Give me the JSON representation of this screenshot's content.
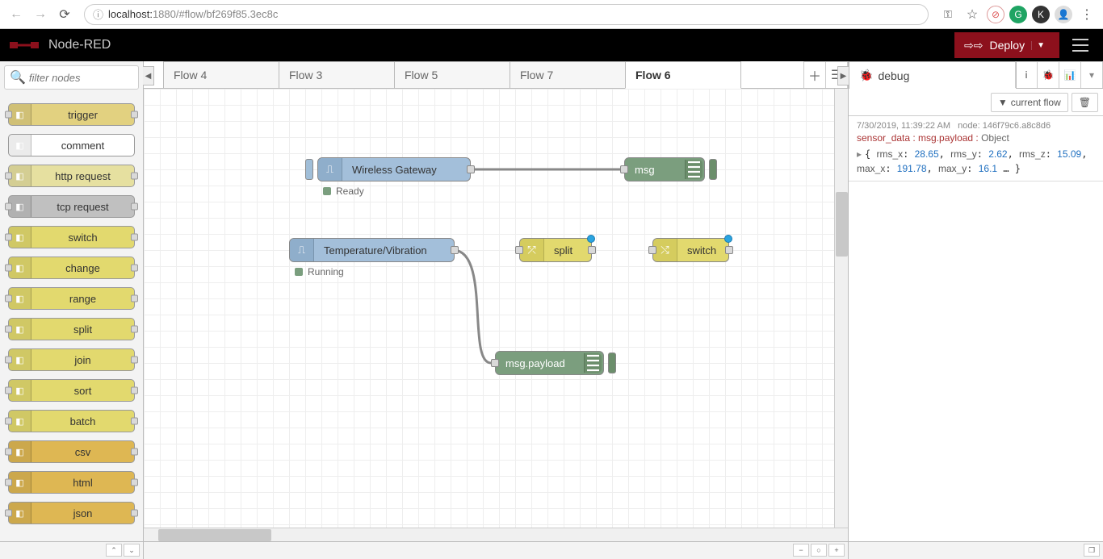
{
  "browser": {
    "url_host": "localhost:",
    "url_port_path": "1880/#flow/bf269f85.3ec8c"
  },
  "header": {
    "title": "Node-RED",
    "deploy_label": "Deploy"
  },
  "palette": {
    "filter_placeholder": "filter nodes",
    "nodes": [
      {
        "label": "trigger",
        "color": "#e2d180",
        "ports": "both"
      },
      {
        "label": "comment",
        "color": "#ffffff",
        "ports": "none"
      },
      {
        "label": "http request",
        "color": "#e6e0a0",
        "ports": "both"
      },
      {
        "label": "tcp request",
        "color": "#c0c0c0",
        "ports": "both"
      },
      {
        "label": "switch",
        "color": "#e2d96e",
        "ports": "both"
      },
      {
        "label": "change",
        "color": "#e2d96e",
        "ports": "both"
      },
      {
        "label": "range",
        "color": "#e2d96e",
        "ports": "both"
      },
      {
        "label": "split",
        "color": "#e2d96e",
        "ports": "both"
      },
      {
        "label": "join",
        "color": "#e2d96e",
        "ports": "both"
      },
      {
        "label": "sort",
        "color": "#e2d96e",
        "ports": "both"
      },
      {
        "label": "batch",
        "color": "#e2d96e",
        "ports": "both"
      },
      {
        "label": "csv",
        "color": "#deb753",
        "ports": "both"
      },
      {
        "label": "html",
        "color": "#deb753",
        "ports": "both"
      },
      {
        "label": "json",
        "color": "#deb753",
        "ports": "both"
      }
    ]
  },
  "tabs": {
    "items": [
      "Flow 4",
      "Flow 3",
      "Flow 5",
      "Flow 7",
      "Flow 6"
    ],
    "active_index": 4
  },
  "canvas": {
    "nodes": {
      "gateway": {
        "label": "Wireless Gateway",
        "status": "Ready"
      },
      "msg": {
        "label": "msg"
      },
      "tempvib": {
        "label": "Temperature/Vibration",
        "status": "Running"
      },
      "split": {
        "label": "split"
      },
      "switch": {
        "label": "switch"
      },
      "payload": {
        "label": "msg.payload"
      }
    }
  },
  "sidebar": {
    "tab_label": "debug",
    "filter_label": "current flow",
    "msg": {
      "time": "7/30/2019, 11:39:22 AM",
      "node": "node: 146f79c6.a8c8d6",
      "topic": "sensor_data : msg.payload : ",
      "topic_type": "Object",
      "data": {
        "rms_x": "28.65",
        "rms_y": "2.62",
        "rms_z": "15.09",
        "max_x": "191.78",
        "max_y": "16.1"
      }
    }
  }
}
